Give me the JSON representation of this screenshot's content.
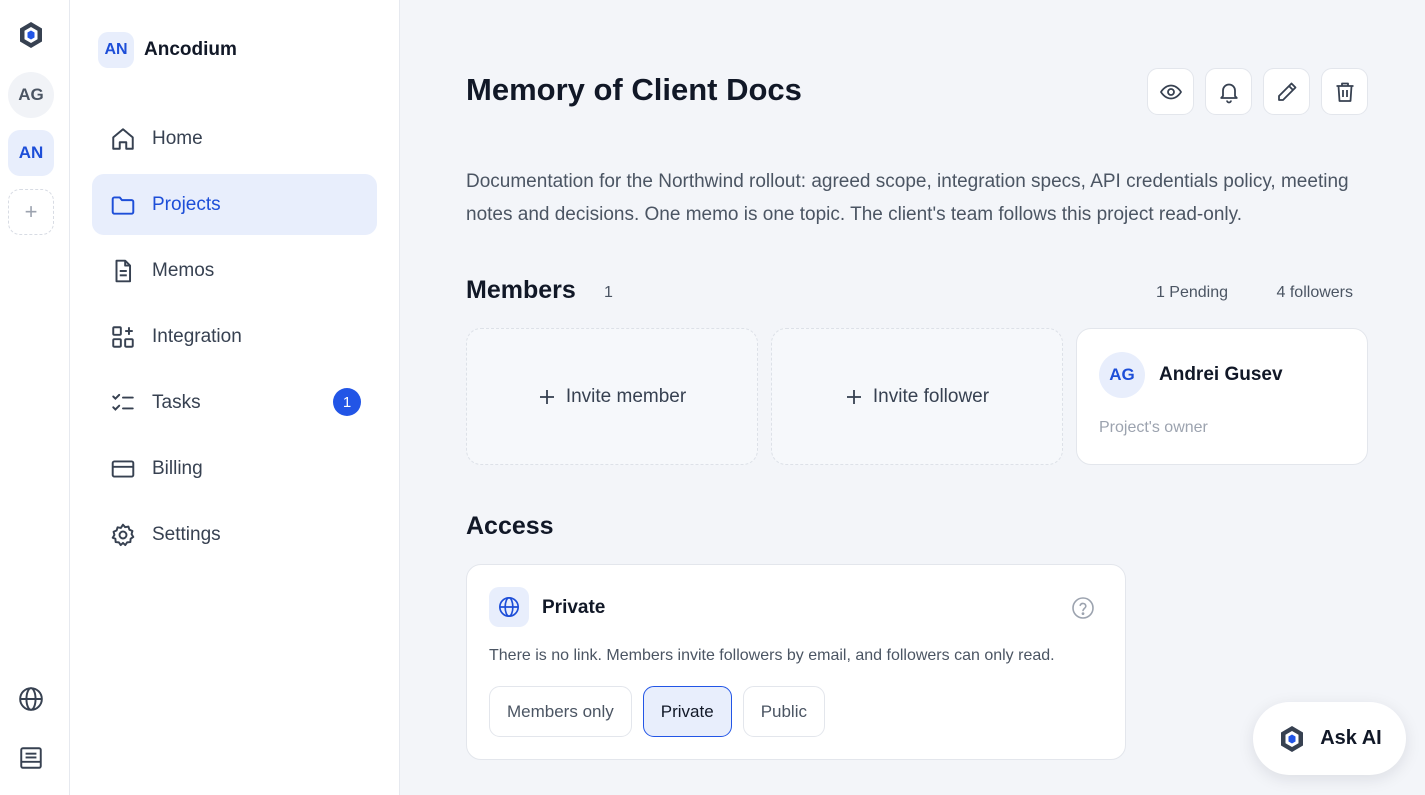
{
  "rail": {
    "avatars": [
      "AG",
      "AN"
    ],
    "add_label": "+"
  },
  "sidebar": {
    "workspace": {
      "initials": "AN",
      "name": "Ancodium"
    },
    "items": [
      {
        "label": "Home",
        "icon": "home-icon"
      },
      {
        "label": "Projects",
        "icon": "folder-icon",
        "active": true
      },
      {
        "label": "Memos",
        "icon": "document-icon"
      },
      {
        "label": "Integration",
        "icon": "grid-plus-icon"
      },
      {
        "label": "Tasks",
        "icon": "checklist-icon",
        "badge": "1"
      },
      {
        "label": "Billing",
        "icon": "credit-card-icon"
      },
      {
        "label": "Settings",
        "icon": "gear-icon"
      }
    ]
  },
  "main": {
    "title": "Memory of Client Docs",
    "description": "Documentation for the Northwind rollout: agreed scope, integration specs, API credentials policy, meeting notes and decisions. One memo is one topic. The client's team follows this project read-only.",
    "members": {
      "heading": "Members",
      "count": "1",
      "pending": "1 Pending",
      "followers": "4 followers",
      "invite_member": "Invite member",
      "invite_follower": "Invite follower",
      "owner": {
        "initials": "AG",
        "name": "Andrei Gusev",
        "role": "Project's owner"
      }
    },
    "access": {
      "heading": "Access",
      "title": "Private",
      "description": "There is no link. Members invite followers by email, and followers can only read.",
      "options": [
        "Members only",
        "Private",
        "Public"
      ],
      "selected": "Private"
    }
  },
  "ask_ai": {
    "label": "Ask AI"
  },
  "colors": {
    "accent": "#2255e6",
    "accent_soft": "#e8eefc",
    "background": "#f3f5f9"
  }
}
